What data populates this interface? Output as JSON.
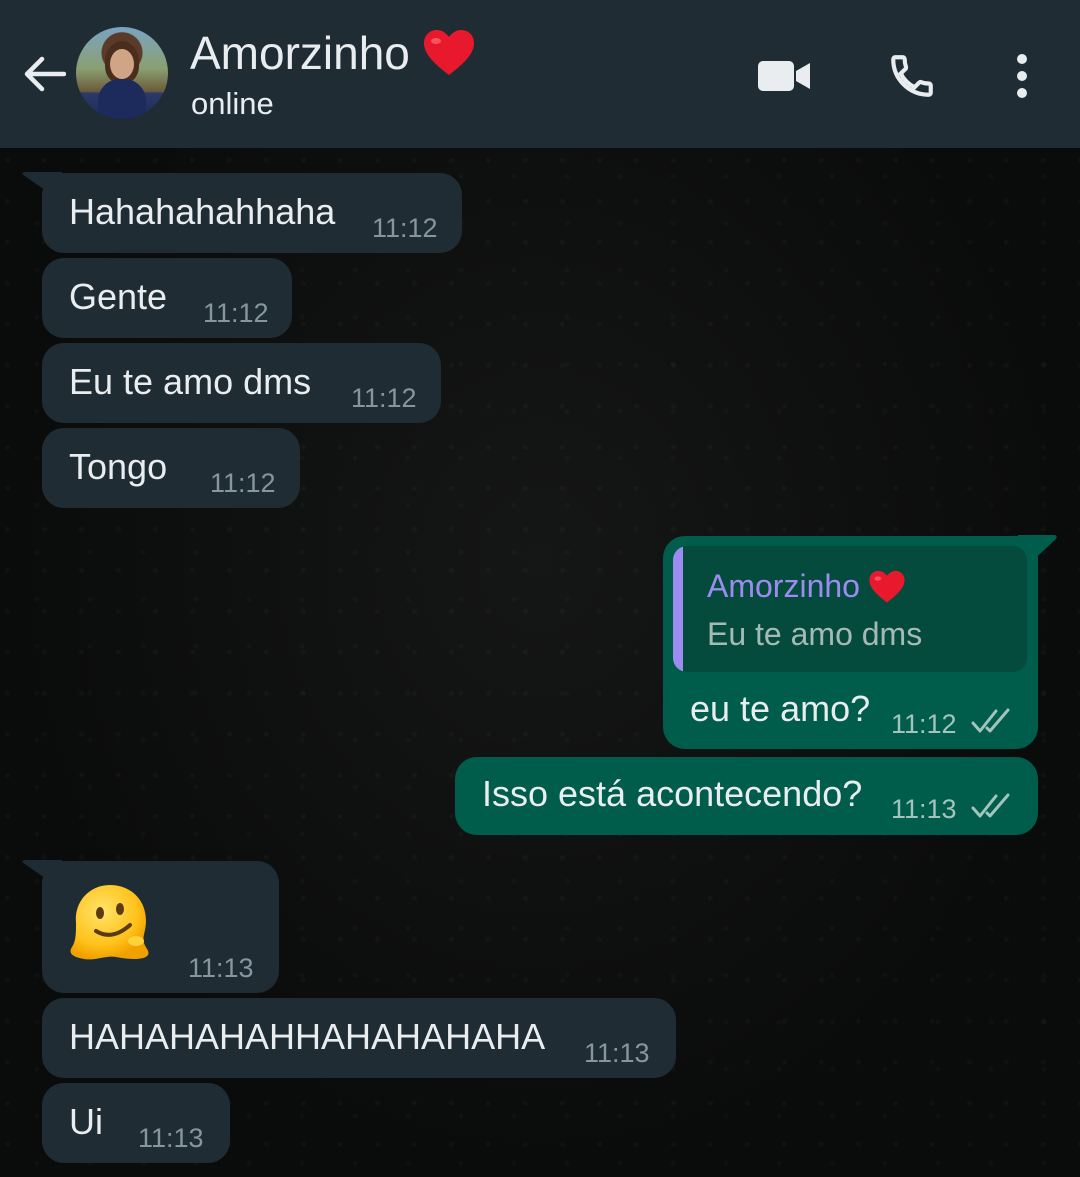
{
  "header": {
    "contact_name": "Amorzinho",
    "status": "online",
    "heart_icon": "red-heart-icon"
  },
  "colors": {
    "header_bg": "#1f2c34",
    "incoming_bubble": "#1f2c34",
    "outgoing_bubble": "#005c4b",
    "quote_accent": "#9c8cf0",
    "heart": "#e8192c"
  },
  "messages": [
    {
      "direction": "in",
      "text": "Hahahahahhaha",
      "time": "11:12"
    },
    {
      "direction": "in",
      "text": "Gente",
      "time": "11:12"
    },
    {
      "direction": "in",
      "text": "Eu te amo dms",
      "time": "11:12"
    },
    {
      "direction": "in",
      "text": "Tongo",
      "time": "11:12"
    },
    {
      "direction": "out",
      "text": "eu te amo?",
      "time": "11:12",
      "status": "read",
      "reply_to": {
        "name": "Amorzinho",
        "text": "Eu te amo dms"
      }
    },
    {
      "direction": "out",
      "text": "Isso está acontecendo?",
      "time": "11:13",
      "status": "read"
    },
    {
      "direction": "in",
      "text": "",
      "emoji": "melting-face-emoji",
      "time": "11:13"
    },
    {
      "direction": "in",
      "text": "HAHAHAHAHHAHAHAHAHA",
      "time": "11:13"
    },
    {
      "direction": "in",
      "text": "Ui",
      "time": "11:13"
    }
  ]
}
